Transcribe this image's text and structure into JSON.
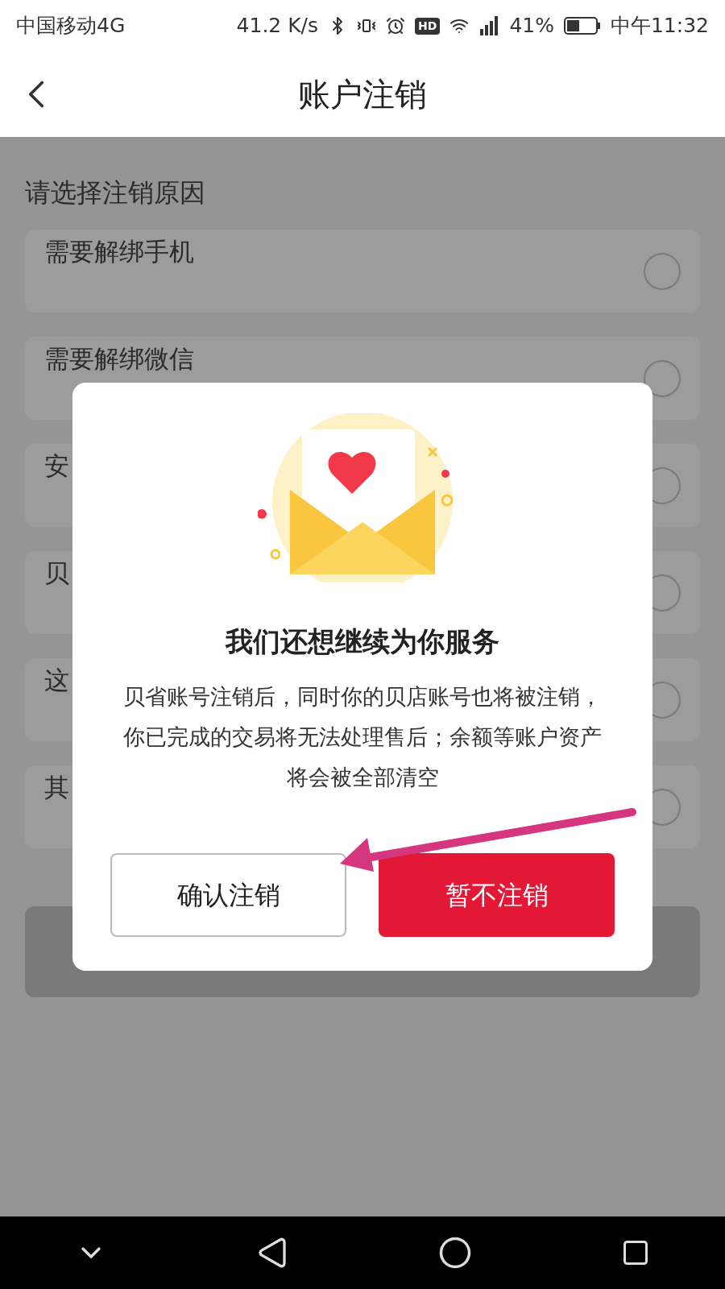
{
  "status_bar": {
    "carrier": "中国移动4G",
    "speed": "41.2 K/s",
    "hd": "HD",
    "battery": "41%",
    "time": "中午11:32"
  },
  "header": {
    "title": "账户注销"
  },
  "section_label": "请选择注销原因",
  "reasons": [
    {
      "label": "需要解绑手机",
      "selected": false
    },
    {
      "label": "需要解绑微信",
      "selected": false
    },
    {
      "label": "安",
      "selected": false
    },
    {
      "label": "贝",
      "selected": false
    },
    {
      "label": "这",
      "selected": false
    },
    {
      "label": "其",
      "selected": false
    }
  ],
  "dialog": {
    "title": "我们还想继续为你服务",
    "message": "贝省账号注销后，同时你的贝店账号也将被注销，你已完成的交易将无法处理售后；余额等账户资产将会被全部清空",
    "buttons": [
      {
        "label": "确认注销",
        "kind": "outline"
      },
      {
        "label": "暂不注销",
        "kind": "primary"
      }
    ]
  }
}
